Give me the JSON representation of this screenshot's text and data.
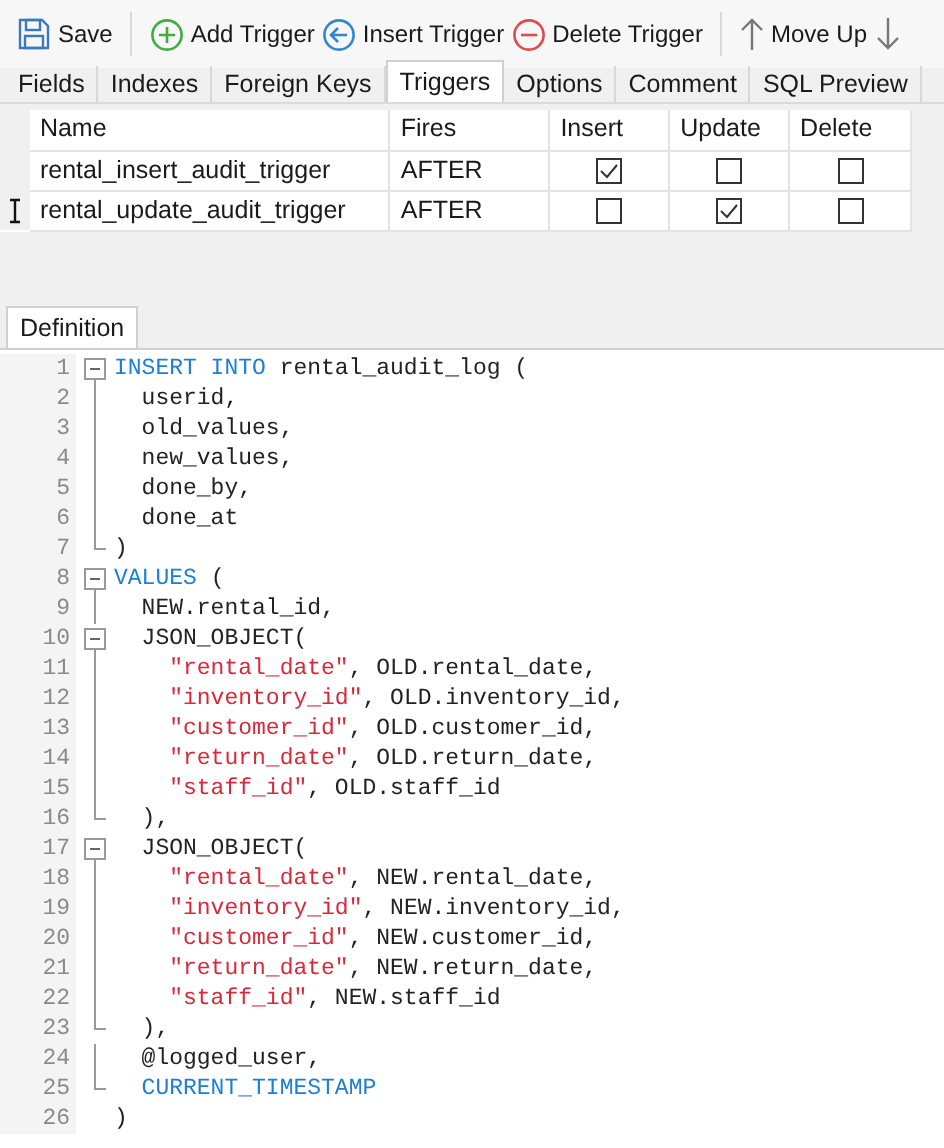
{
  "toolbar": [
    {
      "kind": "save",
      "label": "Save"
    },
    {
      "kind": "separator"
    },
    {
      "kind": "add",
      "label": "Add Trigger"
    },
    {
      "kind": "insert",
      "label": "Insert Trigger"
    },
    {
      "kind": "delete",
      "label": "Delete Trigger"
    },
    {
      "kind": "separator"
    },
    {
      "kind": "up",
      "label": "Move Up"
    },
    {
      "kind": "down"
    }
  ],
  "tabs": [
    {
      "label": "Fields",
      "selected": false
    },
    {
      "label": "Indexes",
      "selected": false
    },
    {
      "label": "Foreign Keys",
      "selected": false
    },
    {
      "label": "Triggers",
      "selected": true
    },
    {
      "label": "Options",
      "selected": false
    },
    {
      "label": "Comment",
      "selected": false
    },
    {
      "label": "SQL Preview",
      "selected": false
    }
  ],
  "table": {
    "columns": [
      "Name",
      "Fires",
      "Insert",
      "Update",
      "Delete"
    ],
    "rows": [
      {
        "name": "rental_insert_audit_trigger",
        "fires": "AFTER",
        "insert": true,
        "update": false,
        "delete": false,
        "cursor": false
      },
      {
        "name": "rental_update_audit_trigger",
        "fires": "AFTER",
        "insert": false,
        "update": true,
        "delete": false,
        "cursor": true
      }
    ]
  },
  "definition": {
    "tab": "Definition",
    "lines": [
      {
        "number": "1",
        "kind": "fold-start",
        "tokens": [
          {
            "kind": "keyword",
            "text": "INSERT INTO"
          },
          {
            "kind": "plain",
            "text": " rental_audit_log ("
          }
        ]
      },
      {
        "number": "2",
        "kind": "fold-line",
        "tokens": [
          {
            "kind": "plain",
            "text": "  userid,"
          }
        ]
      },
      {
        "number": "3",
        "kind": "fold-line",
        "tokens": [
          {
            "kind": "plain",
            "text": "  old_values,"
          }
        ]
      },
      {
        "number": "4",
        "kind": "fold-line",
        "tokens": [
          {
            "kind": "plain",
            "text": "  new_values,"
          }
        ]
      },
      {
        "number": "5",
        "kind": "fold-line",
        "tokens": [
          {
            "kind": "plain",
            "text": "  done_by,"
          }
        ]
      },
      {
        "number": "6",
        "kind": "fold-line",
        "tokens": [
          {
            "kind": "plain",
            "text": "  done_at"
          }
        ]
      },
      {
        "number": "7",
        "kind": "fold-end",
        "tokens": [
          {
            "kind": "plain",
            "text": ")"
          }
        ]
      },
      {
        "number": "8",
        "kind": "fold-start",
        "tokens": [
          {
            "kind": "keyword",
            "text": "VALUES"
          },
          {
            "kind": "plain",
            "text": " ("
          }
        ]
      },
      {
        "number": "9",
        "kind": "fold-line",
        "tokens": [
          {
            "kind": "plain",
            "text": "  NEW.rental_id,"
          }
        ]
      },
      {
        "number": "10",
        "kind": "fold-start",
        "tokens": [
          {
            "kind": "plain",
            "text": "  JSON_OBJECT("
          }
        ]
      },
      {
        "number": "11",
        "kind": "fold-line",
        "tokens": [
          {
            "kind": "string",
            "text": "    \"rental_date\""
          },
          {
            "kind": "plain",
            "text": ", OLD.rental_date,"
          }
        ]
      },
      {
        "number": "12",
        "kind": "fold-line",
        "tokens": [
          {
            "kind": "string",
            "text": "    \"inventory_id\""
          },
          {
            "kind": "plain",
            "text": ", OLD.inventory_id,"
          }
        ]
      },
      {
        "number": "13",
        "kind": "fold-line",
        "tokens": [
          {
            "kind": "string",
            "text": "    \"customer_id\""
          },
          {
            "kind": "plain",
            "text": ", OLD.customer_id,"
          }
        ]
      },
      {
        "number": "14",
        "kind": "fold-line",
        "tokens": [
          {
            "kind": "string",
            "text": "    \"return_date\""
          },
          {
            "kind": "plain",
            "text": ", OLD.return_date,"
          }
        ]
      },
      {
        "number": "15",
        "kind": "fold-line",
        "tokens": [
          {
            "kind": "string",
            "text": "    \"staff_id\""
          },
          {
            "kind": "plain",
            "text": ", OLD.staff_id"
          }
        ]
      },
      {
        "number": "16",
        "kind": "fold-end",
        "tokens": [
          {
            "kind": "plain",
            "text": "  ),"
          }
        ]
      },
      {
        "number": "17",
        "kind": "fold-start",
        "tokens": [
          {
            "kind": "plain",
            "text": "  JSON_OBJECT("
          }
        ]
      },
      {
        "number": "18",
        "kind": "fold-line",
        "tokens": [
          {
            "kind": "string",
            "text": "    \"rental_date\""
          },
          {
            "kind": "plain",
            "text": ", NEW.rental_date,"
          }
        ]
      },
      {
        "number": "19",
        "kind": "fold-line",
        "tokens": [
          {
            "kind": "string",
            "text": "    \"inventory_id\""
          },
          {
            "kind": "plain",
            "text": ", NEW.inventory_id,"
          }
        ]
      },
      {
        "number": "20",
        "kind": "fold-line",
        "tokens": [
          {
            "kind": "string",
            "text": "    \"customer_id\""
          },
          {
            "kind": "plain",
            "text": ", NEW.customer_id,"
          }
        ]
      },
      {
        "number": "21",
        "kind": "fold-line",
        "tokens": [
          {
            "kind": "string",
            "text": "    \"return_date\""
          },
          {
            "kind": "plain",
            "text": ", NEW.return_date,"
          }
        ]
      },
      {
        "number": "22",
        "kind": "fold-line",
        "tokens": [
          {
            "kind": "string",
            "text": "    \"staff_id\""
          },
          {
            "kind": "plain",
            "text": ", NEW.staff_id"
          }
        ]
      },
      {
        "number": "23",
        "kind": "fold-end",
        "tokens": [
          {
            "kind": "plain",
            "text": "  ),"
          }
        ]
      },
      {
        "number": "24",
        "kind": "fold-line",
        "tokens": [
          {
            "kind": "plain",
            "text": "  @logged_user,"
          }
        ]
      },
      {
        "number": "25",
        "kind": "fold-end",
        "tokens": [
          {
            "kind": "keyword",
            "text": "  CURRENT_TIMESTAMP"
          }
        ]
      },
      {
        "number": "26",
        "kind": "plain",
        "tokens": [
          {
            "kind": "plain",
            "text": ")"
          }
        ]
      }
    ]
  }
}
